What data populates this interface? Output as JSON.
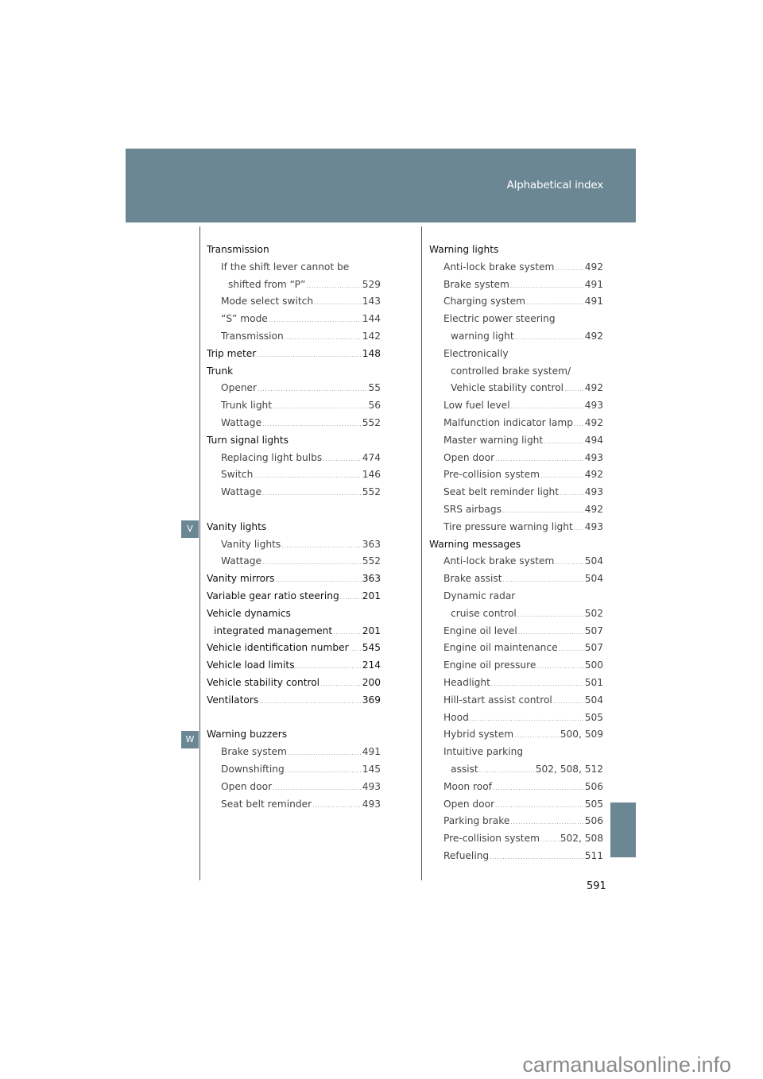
{
  "header": {
    "title": "Alphabetical index",
    "color": "#6b8794"
  },
  "letter_tabs": {
    "v": "V",
    "w": "W"
  },
  "left_column": [
    {
      "type": "main",
      "text": "Transmission",
      "page": ""
    },
    {
      "type": "sub",
      "text": "If the shift lever cannot be",
      "page": ""
    },
    {
      "type": "sub2",
      "text": "shifted from “P”",
      "page": "529"
    },
    {
      "type": "sub",
      "text": "Mode select switch",
      "page": "143"
    },
    {
      "type": "sub",
      "text": "“S” mode",
      "page": "144"
    },
    {
      "type": "sub",
      "text": "Transmission",
      "page": "142"
    },
    {
      "type": "main",
      "text": "Trip meter",
      "page": "148"
    },
    {
      "type": "main",
      "text": "Trunk",
      "page": ""
    },
    {
      "type": "sub",
      "text": "Opener",
      "page": "55"
    },
    {
      "type": "sub",
      "text": "Trunk light",
      "page": "56"
    },
    {
      "type": "sub",
      "text": "Wattage",
      "page": "552"
    },
    {
      "type": "main",
      "text": "Turn signal lights",
      "page": ""
    },
    {
      "type": "sub",
      "text": "Replacing light bulbs",
      "page": "474"
    },
    {
      "type": "sub",
      "text": "Switch",
      "page": "146"
    },
    {
      "type": "sub",
      "text": "Wattage",
      "page": "552"
    },
    {
      "type": "gap",
      "text": "",
      "page": ""
    },
    {
      "type": "main",
      "text": "Vanity lights",
      "page": ""
    },
    {
      "type": "sub",
      "text": "Vanity lights",
      "page": "363"
    },
    {
      "type": "sub",
      "text": "Wattage",
      "page": "552"
    },
    {
      "type": "main",
      "text": "Vanity mirrors",
      "page": "363"
    },
    {
      "type": "main",
      "text": "Variable gear ratio steering",
      "page": "201"
    },
    {
      "type": "main",
      "text": "Vehicle dynamics",
      "page": ""
    },
    {
      "type": "cont",
      "text": "integrated management",
      "page": "201"
    },
    {
      "type": "main",
      "text": "Vehicle identification number",
      "page": "545"
    },
    {
      "type": "main",
      "text": "Vehicle load limits",
      "page": "214"
    },
    {
      "type": "main",
      "text": "Vehicle stability control",
      "page": "200"
    },
    {
      "type": "main",
      "text": "Ventilators",
      "page": "369"
    },
    {
      "type": "gap",
      "text": "",
      "page": ""
    },
    {
      "type": "main",
      "text": "Warning buzzers",
      "page": ""
    },
    {
      "type": "sub",
      "text": "Brake system",
      "page": "491"
    },
    {
      "type": "sub",
      "text": "Downshifting",
      "page": "145"
    },
    {
      "type": "sub",
      "text": "Open door",
      "page": "493"
    },
    {
      "type": "sub",
      "text": "Seat belt reminder",
      "page": "493"
    }
  ],
  "right_column": [
    {
      "type": "main",
      "text": "Warning lights",
      "page": ""
    },
    {
      "type": "sub",
      "text": "Anti-lock brake system",
      "page": "492"
    },
    {
      "type": "sub",
      "text": "Brake system",
      "page": "491"
    },
    {
      "type": "sub",
      "text": "Charging system",
      "page": "491"
    },
    {
      "type": "sub",
      "text": "Electric power steering",
      "page": ""
    },
    {
      "type": "sub2",
      "text": "warning light",
      "page": "492"
    },
    {
      "type": "sub",
      "text": "Electronically",
      "page": ""
    },
    {
      "type": "sub2",
      "text": "controlled brake system/",
      "page": ""
    },
    {
      "type": "sub2",
      "text": "Vehicle stability control",
      "page": "492"
    },
    {
      "type": "sub",
      "text": "Low fuel level",
      "page": "493"
    },
    {
      "type": "sub",
      "text": "Malfunction indicator lamp",
      "page": "492"
    },
    {
      "type": "sub",
      "text": "Master warning light",
      "page": "494"
    },
    {
      "type": "sub",
      "text": "Open door",
      "page": "493"
    },
    {
      "type": "sub",
      "text": "Pre-collision system",
      "page": "492"
    },
    {
      "type": "sub",
      "text": "Seat belt reminder light",
      "page": "493"
    },
    {
      "type": "sub",
      "text": "SRS airbags",
      "page": "492"
    },
    {
      "type": "sub",
      "text": "Tire pressure warning light",
      "page": "493"
    },
    {
      "type": "main",
      "text": "Warning messages",
      "page": ""
    },
    {
      "type": "sub",
      "text": "Anti-lock brake system",
      "page": "504"
    },
    {
      "type": "sub",
      "text": "Brake assist",
      "page": "504"
    },
    {
      "type": "sub",
      "text": "Dynamic radar",
      "page": ""
    },
    {
      "type": "sub2",
      "text": "cruise control",
      "page": "502"
    },
    {
      "type": "sub",
      "text": "Engine oil level",
      "page": "507"
    },
    {
      "type": "sub",
      "text": "Engine oil maintenance",
      "page": "507"
    },
    {
      "type": "sub",
      "text": "Engine oil pressure",
      "page": "500"
    },
    {
      "type": "sub",
      "text": "Headlight",
      "page": "501"
    },
    {
      "type": "sub",
      "text": "Hill-start assist control",
      "page": "504"
    },
    {
      "type": "sub",
      "text": "Hood",
      "page": "505"
    },
    {
      "type": "sub",
      "text": "Hybrid system",
      "page": "500, 509"
    },
    {
      "type": "sub",
      "text": "Intuitive parking",
      "page": ""
    },
    {
      "type": "sub2",
      "text": "assist",
      "page": "502, 508, 512"
    },
    {
      "type": "sub",
      "text": "Moon roof",
      "page": "506"
    },
    {
      "type": "sub",
      "text": "Open door",
      "page": "505"
    },
    {
      "type": "sub",
      "text": "Parking brake",
      "page": "506"
    },
    {
      "type": "sub",
      "text": "Pre-collision system",
      "page": "502, 508"
    },
    {
      "type": "sub",
      "text": "Refueling",
      "page": "511"
    }
  ],
  "page_number": "591",
  "watermark": "carmanualsonline.info"
}
